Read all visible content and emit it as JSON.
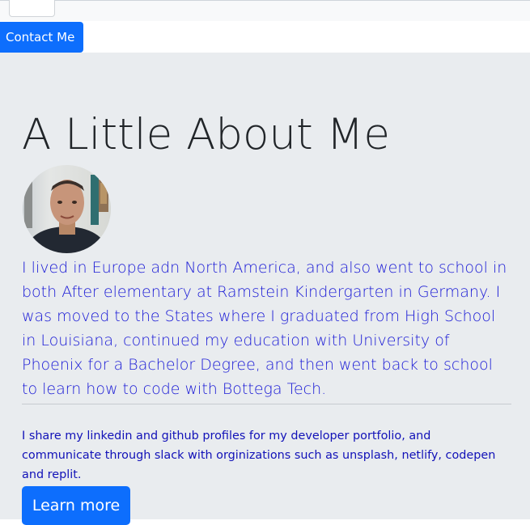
{
  "nav": {
    "contact_label": "Contact Me"
  },
  "about": {
    "heading": "A Little About Me",
    "bio": "I lived in Europe adn North America, and also went to school in both After elementary at Ramstein Kindergarten in Germany. I was moved to the States where I graduated from High School in Louisiana, continued my education with University of Phoenix for a Bachelor Degree, and then went back to school to learn how to code with Bottega Tech.",
    "info": "I share my linkedin and github profiles for my developer portfolio, and communicate through slack with orginizations such as unsplash, netlify, codepen and replit.",
    "learn_more_label": "Learn more"
  },
  "colors": {
    "primary": "#0d6efd",
    "jumbotron_bg": "#e9ecef",
    "bio_text": "#1a1ad6",
    "info_text": "#1111b8"
  }
}
